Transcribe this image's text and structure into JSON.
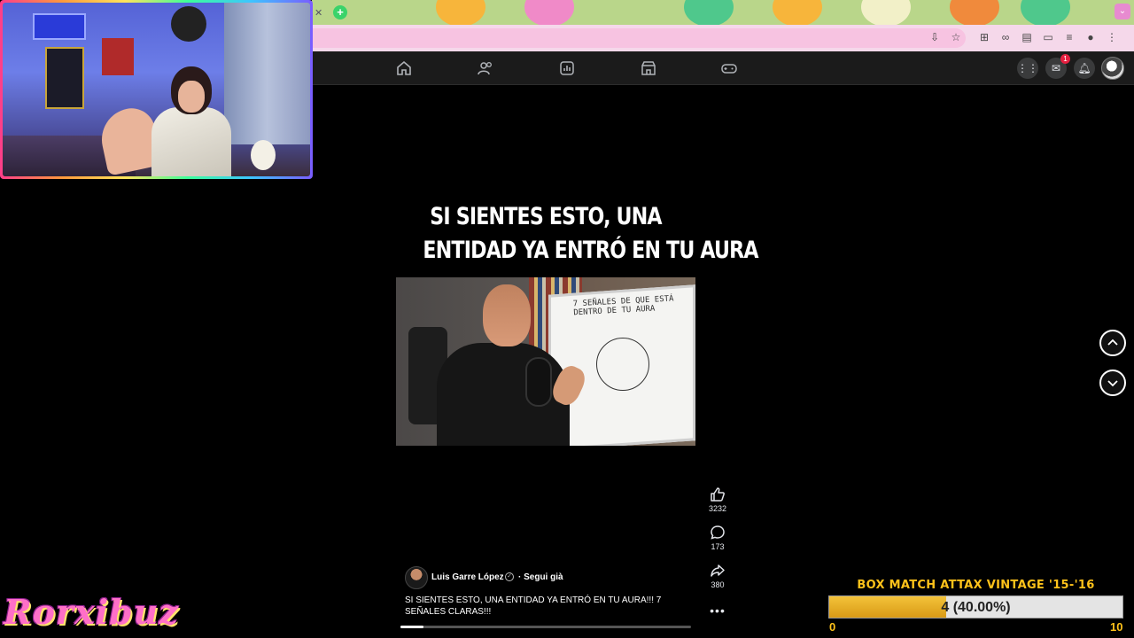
{
  "browser": {
    "colors": {
      "tabstrip": "#b9d68a",
      "addressbar": "#f5d8ea",
      "newtab": "#3ad36a"
    },
    "addr_icons": [
      "install-icon",
      "star-icon",
      "translate-icon",
      "link-icon",
      "reader-icon",
      "cast-icon",
      "extensions-icon",
      "profile-icon",
      "menu-icon"
    ]
  },
  "facebook": {
    "nav_icons": [
      "home-icon",
      "friends-icon",
      "dashboard-icon",
      "marketplace-icon",
      "gaming-icon"
    ],
    "messenger_badge": "1"
  },
  "reel": {
    "title_line1": "SI SIENTES ESTO, UNA",
    "title_line2": "ENTIDAD YA ENTRÓ EN TU AURA",
    "board_text": "7 SEÑALES DE QUE ESTÁ DENTRO DE TU AURA",
    "likes": "3232",
    "comments": "173",
    "shares": "380",
    "author": "Luis Garre López",
    "follow": "· Segui già",
    "caption": "SI SIENTES ESTO, UNA ENTIDAD YA ENTRÓ EN TU AURA!!! 7 SEÑALES CLARAS!!!",
    "progress_fraction": 0.08
  },
  "overlay": {
    "streamer_name": "Rorxibuz",
    "box_match": {
      "title": "BOX MATCH ATTAX VINTAGE '15-'16",
      "value_label": "4 (40.00%)",
      "min": "0",
      "max": "10",
      "fraction": 0.4
    }
  }
}
